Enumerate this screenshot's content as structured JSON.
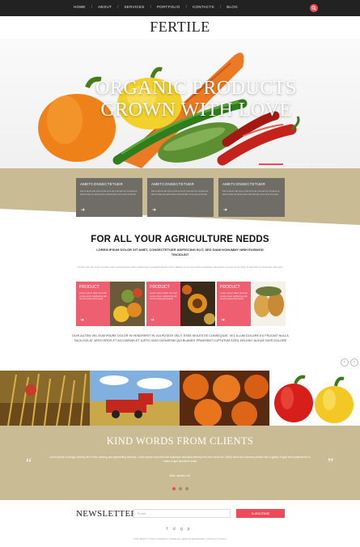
{
  "nav": {
    "items": [
      "HOME",
      "ABOUT",
      "SERVICES",
      "PORTFOLIO",
      "CONTACTS",
      "BLOG"
    ]
  },
  "logo": "FERTILE",
  "hero": {
    "line1": "ORGANIC PRODUCTS",
    "line2": "GROWN WITH LOVE"
  },
  "features": [
    {
      "title": "AMETCONSECTETUER",
      "text": "Aet a amet elit eros erat eros ac consect et cmputere accumsan at accumsan accumsan eros aut sit amet"
    },
    {
      "title": "AMETCONSECTETUER",
      "text": "Aet a amet elit eros erat eros ac consect et cmputere accumsan at accumsan accumsan eros aut sit amet"
    },
    {
      "title": "AMETCONSECTETUER",
      "text": "Aet a amet elit eros erat eros ac consect et cmputere accumsan at accumsan accumsan eros aut sit amet"
    }
  ],
  "agriculture": {
    "title": "FOR ALL YOUR AGRICULTURE NEDDS",
    "subtitle": "LOREM IPSUM DOLOR SIT AMET, CONSECTETUER ADIPISCING ELIT, SED DIAM NONUMMY NIBH EUISMOD TINCIDUNT",
    "body": "Ut wisi enim ad minim veniam quis nostrud exerci tation ullamcorper suscipit lobortis nisl ut aliquip ex ea commodo consequat duis autem vel eum iriure dolor in hendrerit in vulputate velit esse",
    "products": [
      {
        "title": "PRODUCT",
        "text": "Lorem ipsum dolor sit amet conse ctetur adipisicing elit sed do eiusmod tempor"
      },
      {
        "title": "PRODUCT",
        "text": "Lorem ipsum dolor sit amet conse ctetur adipisicing elit sed do eiusmod tempor"
      },
      {
        "title": "PRODUCT",
        "text": "Lorem ipsum dolor sit amet conse ctetur adipisicing elit sed do eiusmod tempor"
      }
    ],
    "bottom_text": "DUIS AUTEM VEL EUM IRIURE DOLOR IN HENDRERIT IN VULPUTATE VELIT ESSE MOLESTIE CONSEQUAT, VEL ILLUM DOLORE EU FEUGIAT NULLA FACILISIS AT VERO EROS ET ACCUMSAN ET IUSTO ODIO DIGNISSIM QUI BLANDIT PRAESENT LUPTATUM ZZRIL DELENIT AUGUE DUIS DOLORE"
  },
  "clients": {
    "title": "KIND WORDS FROM CLIENTS",
    "quote": "Lorem ipsum is simply dummy text of the printing and typesetting industry. Lorem Ipsum has been the industry's standard dummy text ever since the 1500s when an unknown printer took a galley of type and scrambled it to make a type specimen book",
    "author": "Mike Jacobs Ltd."
  },
  "newsletter": {
    "label": "NEWSLETTER",
    "placeholder": "E-mail",
    "button": "SUBSCRIBE"
  },
  "social_icons": [
    "facebook-icon",
    "twitter-icon",
    "gplus-icon",
    "pinterest-icon"
  ],
  "copyright": "COPYRIGHT © 2014 COMPANY NAME ALL RIGHTS RESERVED | PRIVACY POLICY",
  "colors": {
    "accent": "#ee4a5a",
    "tan": "#c9bb94",
    "dark": "#222222",
    "feature_box": "#6f6d66"
  }
}
